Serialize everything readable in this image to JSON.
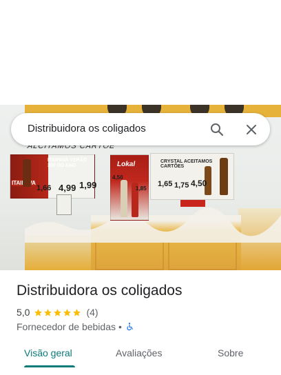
{
  "search": {
    "query": "Distribuidora os coligados"
  },
  "place": {
    "name": "Distribuidora os coligados",
    "rating": "5,0",
    "review_count": "(4)",
    "category": "Fornecedor de bebidas",
    "separator": "•",
    "stars": 5
  },
  "photo": {
    "wall_text": "ALCITAMOS CARTÕE",
    "poster1": {
      "label": "ITAIPAVA VERÃO 300 DO ANO",
      "brand": "ITAIPAVA",
      "prices": [
        "1,66",
        "4,99",
        "1,99"
      ]
    },
    "poster2": {
      "brand": "Lokal",
      "prices": [
        "4,50",
        "1,85"
      ]
    },
    "poster3": {
      "brand": "CRYSTAL ACEITAMOS CARTÕES",
      "prices": [
        "1,65",
        "1,75",
        "4,50"
      ]
    }
  },
  "tabs": [
    {
      "label": "Visão geral",
      "active": true
    },
    {
      "label": "Avaliações",
      "active": false
    },
    {
      "label": "Sobre",
      "active": false
    }
  ],
  "colors": {
    "accent": "#0b7a7a",
    "star": "#fbbc04",
    "accessibility": "#1a73e8"
  },
  "icons": {
    "search": "search-icon",
    "close": "close-icon",
    "accessibility": "wheelchair-icon"
  }
}
